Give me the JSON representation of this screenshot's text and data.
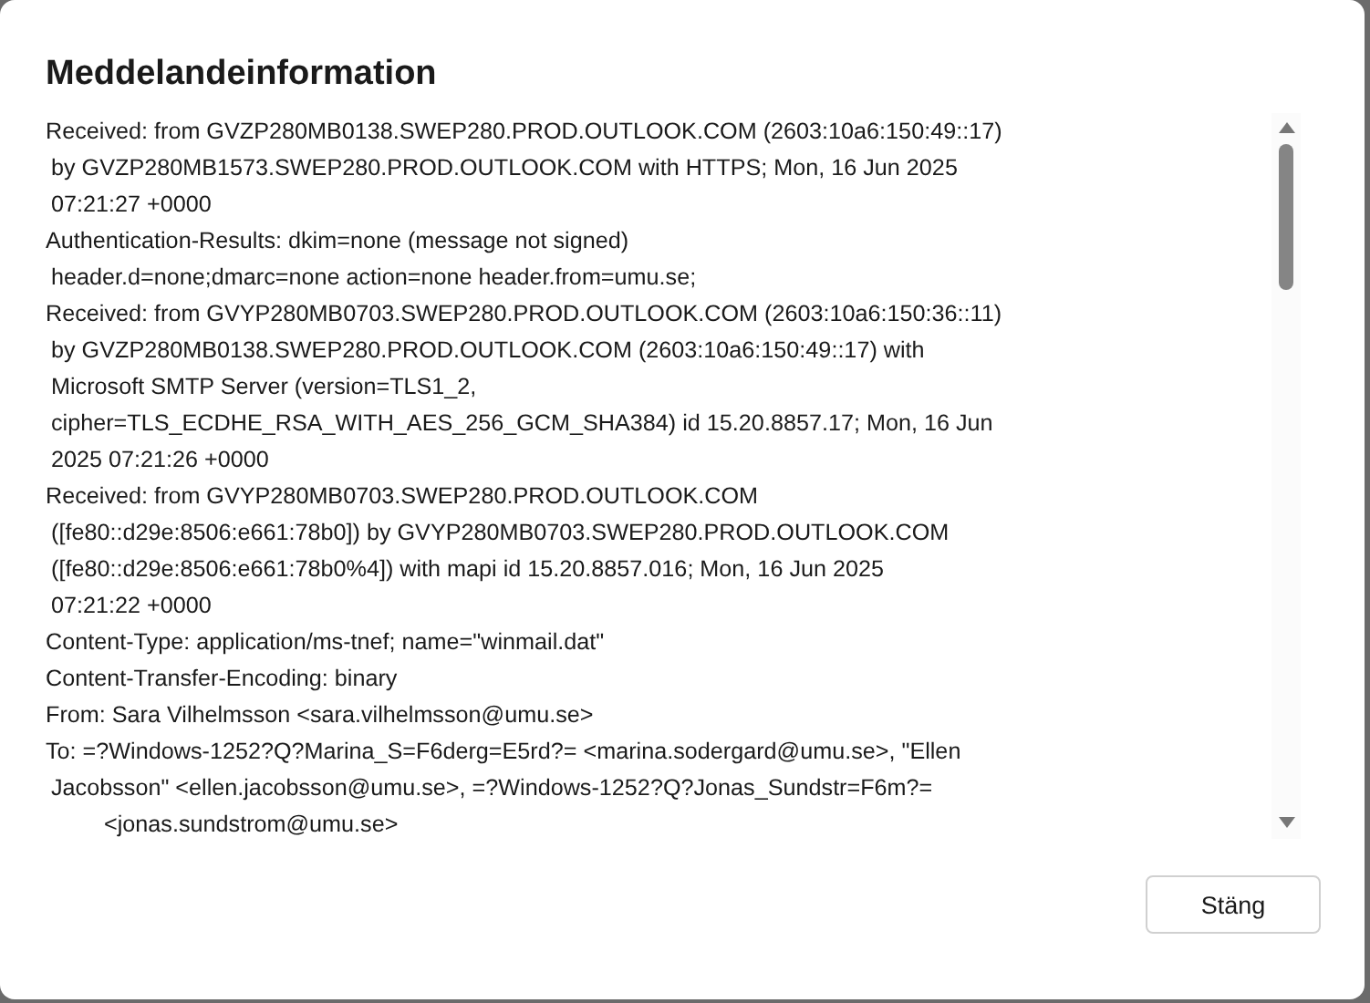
{
  "dialog": {
    "title": "Meddelandeinformation"
  },
  "header_lines": [
    {
      "kind": "start",
      "text": "Received: from GVZP280MB0138.SWEP280.PROD.OUTLOOK.COM (2603:10a6:150:49::17)"
    },
    {
      "kind": "wrap",
      "text": "by GVZP280MB1573.SWEP280.PROD.OUTLOOK.COM with HTTPS; Mon, 16 Jun 2025"
    },
    {
      "kind": "wrap",
      "text": "07:21:27 +0000"
    },
    {
      "kind": "start",
      "text": "Authentication-Results: dkim=none (message not signed)"
    },
    {
      "kind": "wrap",
      "text": "header.d=none;dmarc=none action=none header.from=umu.se;"
    },
    {
      "kind": "start",
      "text": "Received: from GVYP280MB0703.SWEP280.PROD.OUTLOOK.COM (2603:10a6:150:36::11)"
    },
    {
      "kind": "wrap",
      "text": "by GVZP280MB0138.SWEP280.PROD.OUTLOOK.COM (2603:10a6:150:49::17) with"
    },
    {
      "kind": "wrap",
      "text": "Microsoft SMTP Server (version=TLS1_2,"
    },
    {
      "kind": "wrap",
      "text": "cipher=TLS_ECDHE_RSA_WITH_AES_256_GCM_SHA384) id 15.20.8857.17; Mon, 16 Jun"
    },
    {
      "kind": "wrap",
      "text": "2025 07:21:26 +0000"
    },
    {
      "kind": "start",
      "text": "Received: from GVYP280MB0703.SWEP280.PROD.OUTLOOK.COM"
    },
    {
      "kind": "wrap",
      "text": "([fe80::d29e:8506:e661:78b0]) by GVYP280MB0703.SWEP280.PROD.OUTLOOK.COM"
    },
    {
      "kind": "wrap",
      "text": "([fe80::d29e:8506:e661:78b0%4]) with mapi id 15.20.8857.016; Mon, 16 Jun 2025"
    },
    {
      "kind": "wrap",
      "text": "07:21:22 +0000"
    },
    {
      "kind": "start",
      "text": "Content-Type: application/ms-tnef; name=\"winmail.dat\""
    },
    {
      "kind": "start",
      "text": "Content-Transfer-Encoding: binary"
    },
    {
      "kind": "start",
      "text": "From: Sara Vilhelmsson <sara.vilhelmsson@umu.se>"
    },
    {
      "kind": "start",
      "text": "To: =?Windows-1252?Q?Marina_S=F6derg=E5rd?= <marina.sodergard@umu.se>, \"Ellen"
    },
    {
      "kind": "wrap",
      "text": "Jacobsson\" <ellen.jacobsson@umu.se>, =?Windows-1252?Q?Jonas_Sundstr=F6m?="
    },
    {
      "kind": "tab",
      "text": "<jonas.sundstrom@umu.se>"
    }
  ],
  "buttons": [
    {
      "label": "Stäng"
    }
  ]
}
